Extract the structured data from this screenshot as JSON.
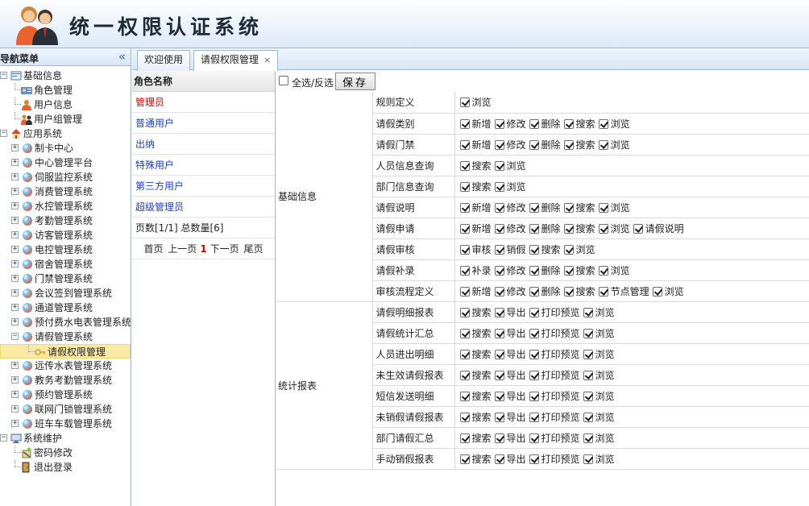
{
  "app": {
    "title": "统一权限认证系统"
  },
  "sidebar": {
    "title": "导航菜单",
    "collapse_glyph": "«",
    "tree": [
      {
        "label": "基础信息",
        "depth": 0,
        "kind": "folder",
        "expander": "−",
        "icon": "folder-icon"
      },
      {
        "label": "角色管理",
        "depth": 1,
        "kind": "leaf",
        "icon": "role-icon"
      },
      {
        "label": "用户信息",
        "depth": 1,
        "kind": "leaf",
        "icon": "user-icon"
      },
      {
        "label": "用户组管理",
        "depth": 1,
        "kind": "leaf",
        "icon": "group-icon"
      },
      {
        "label": "应用系统",
        "depth": 0,
        "kind": "folder",
        "expander": "−",
        "icon": "house-icon"
      },
      {
        "label": "制卡中心",
        "depth": 1,
        "kind": "app",
        "expander": "+"
      },
      {
        "label": "中心管理平台",
        "depth": 1,
        "kind": "app",
        "expander": "+"
      },
      {
        "label": "伺服监控系统",
        "depth": 1,
        "kind": "app",
        "expander": "+"
      },
      {
        "label": "消费管理系统",
        "depth": 1,
        "kind": "app",
        "expander": "+"
      },
      {
        "label": "水控管理系统",
        "depth": 1,
        "kind": "app",
        "expander": "+"
      },
      {
        "label": "考勤管理系统",
        "depth": 1,
        "kind": "app",
        "expander": "+"
      },
      {
        "label": "访客管理系统",
        "depth": 1,
        "kind": "app",
        "expander": "+"
      },
      {
        "label": "电控管理系统",
        "depth": 1,
        "kind": "app",
        "expander": "+"
      },
      {
        "label": "宿舍管理系统",
        "depth": 1,
        "kind": "app",
        "expander": "+"
      },
      {
        "label": "门禁管理系统",
        "depth": 1,
        "kind": "app",
        "expander": "+"
      },
      {
        "label": "会议签到管理系统",
        "depth": 1,
        "kind": "app",
        "expander": "+"
      },
      {
        "label": "通道管理系统",
        "depth": 1,
        "kind": "app",
        "expander": "+"
      },
      {
        "label": "预付费水电表管理系统",
        "depth": 1,
        "kind": "app",
        "expander": "+"
      },
      {
        "label": "请假管理系统",
        "depth": 1,
        "kind": "app",
        "expander": "−"
      },
      {
        "label": "请假权限管理",
        "depth": 2,
        "kind": "leaf",
        "icon": "key-icon",
        "selected": true
      },
      {
        "label": "远传水表管理系统",
        "depth": 1,
        "kind": "app",
        "expander": "+"
      },
      {
        "label": "教务考勤管理系统",
        "depth": 1,
        "kind": "app",
        "expander": "+"
      },
      {
        "label": "预约管理系统",
        "depth": 1,
        "kind": "app",
        "expander": "+"
      },
      {
        "label": "联网门锁管理系统",
        "depth": 1,
        "kind": "app",
        "expander": "+"
      },
      {
        "label": "班车车载管理系统",
        "depth": 1,
        "kind": "app",
        "expander": "+"
      },
      {
        "label": "系统维护",
        "depth": 0,
        "kind": "folder",
        "expander": "−",
        "icon": "monitor-icon"
      },
      {
        "label": "密码修改",
        "depth": 1,
        "kind": "leaf",
        "icon": "password-icon"
      },
      {
        "label": "退出登录",
        "depth": 1,
        "kind": "leaf",
        "icon": "logout-icon"
      }
    ]
  },
  "tabs": [
    {
      "label": "欢迎使用",
      "active": false,
      "closable": false
    },
    {
      "label": "请假权限管理",
      "active": true,
      "closable": true,
      "close_glyph": "×"
    }
  ],
  "roles": {
    "header": "角色名称",
    "items": [
      "管理员",
      "普通用户",
      "出纳",
      "特殊用户",
      "第三方用户",
      "超级管理员"
    ],
    "current_index": 0,
    "pager_info": "页数[1/1]  总数量[6]",
    "pager": {
      "first": "首页",
      "prev": "上一页",
      "current": "1",
      "next": "下一页",
      "last": "尾页"
    }
  },
  "permissions": {
    "select_all_label": "全选/反选",
    "select_all_checked": false,
    "save_label": "保存",
    "groups": [
      {
        "name": "基础信息",
        "rows": [
          {
            "item": "规则定义",
            "actions": [
              [
                "浏览",
                true
              ]
            ]
          },
          {
            "item": "请假类别",
            "actions": [
              [
                "新增",
                true
              ],
              [
                "修改",
                true
              ],
              [
                "删除",
                true
              ],
              [
                "搜索",
                true
              ],
              [
                "浏览",
                true
              ]
            ]
          },
          {
            "item": "请假门禁",
            "actions": [
              [
                "新增",
                true
              ],
              [
                "修改",
                true
              ],
              [
                "删除",
                true
              ],
              [
                "搜索",
                true
              ],
              [
                "浏览",
                true
              ]
            ]
          },
          {
            "item": "人员信息查询",
            "actions": [
              [
                "搜索",
                true
              ],
              [
                "浏览",
                true
              ]
            ]
          },
          {
            "item": "部门信息查询",
            "actions": [
              [
                "搜索",
                true
              ],
              [
                "浏览",
                true
              ]
            ]
          },
          {
            "item": "请假说明",
            "actions": [
              [
                "新增",
                true
              ],
              [
                "修改",
                true
              ],
              [
                "删除",
                true
              ],
              [
                "搜索",
                true
              ],
              [
                "浏览",
                true
              ]
            ]
          },
          {
            "item": "请假申请",
            "actions": [
              [
                "新增",
                true
              ],
              [
                "修改",
                true
              ],
              [
                "删除",
                true
              ],
              [
                "搜索",
                true
              ],
              [
                "浏览",
                true
              ],
              [
                "请假说明",
                true
              ]
            ]
          },
          {
            "item": "请假审核",
            "actions": [
              [
                "审核",
                true
              ],
              [
                "销假",
                true
              ],
              [
                "搜索",
                true
              ],
              [
                "浏览",
                true
              ]
            ]
          },
          {
            "item": "请假补录",
            "actions": [
              [
                "补录",
                true
              ],
              [
                "修改",
                true
              ],
              [
                "删除",
                true
              ],
              [
                "搜索",
                true
              ],
              [
                "浏览",
                true
              ]
            ]
          },
          {
            "item": "审核流程定义",
            "actions": [
              [
                "新增",
                true
              ],
              [
                "修改",
                true
              ],
              [
                "删除",
                true
              ],
              [
                "搜索",
                true
              ],
              [
                "节点管理",
                true
              ],
              [
                "浏览",
                true
              ]
            ]
          }
        ]
      },
      {
        "name": "统计报表",
        "rows": [
          {
            "item": "请假明细报表",
            "actions": [
              [
                "搜索",
                true
              ],
              [
                "导出",
                true
              ],
              [
                "打印预览",
                true
              ],
              [
                "浏览",
                true
              ]
            ]
          },
          {
            "item": "请假统计汇总",
            "actions": [
              [
                "搜索",
                true
              ],
              [
                "导出",
                true
              ],
              [
                "打印预览",
                true
              ],
              [
                "浏览",
                true
              ]
            ]
          },
          {
            "item": "人员进出明细",
            "actions": [
              [
                "搜索",
                true
              ],
              [
                "导出",
                true
              ],
              [
                "打印预览",
                true
              ],
              [
                "浏览",
                true
              ]
            ]
          },
          {
            "item": "未生效请假报表",
            "actions": [
              [
                "搜索",
                true
              ],
              [
                "导出",
                true
              ],
              [
                "打印预览",
                true
              ],
              [
                "浏览",
                true
              ]
            ]
          },
          {
            "item": "短信发送明细",
            "actions": [
              [
                "搜索",
                true
              ],
              [
                "导出",
                true
              ],
              [
                "打印预览",
                true
              ],
              [
                "浏览",
                true
              ]
            ]
          },
          {
            "item": "未销假请假报表",
            "actions": [
              [
                "搜索",
                true
              ],
              [
                "导出",
                true
              ],
              [
                "打印预览",
                true
              ],
              [
                "浏览",
                true
              ]
            ]
          },
          {
            "item": "部门请假汇总",
            "actions": [
              [
                "搜索",
                true
              ],
              [
                "导出",
                true
              ],
              [
                "打印预览",
                true
              ],
              [
                "浏览",
                true
              ]
            ]
          },
          {
            "item": "手动销假报表",
            "actions": [
              [
                "搜索",
                true
              ],
              [
                "导出",
                true
              ],
              [
                "打印预览",
                true
              ],
              [
                "浏览",
                true
              ]
            ]
          }
        ]
      }
    ]
  },
  "colors": {
    "accent": "#1b3fc2",
    "current_role": "#d40000",
    "selection": "#fbe9a6",
    "border": "#9db7d6"
  }
}
